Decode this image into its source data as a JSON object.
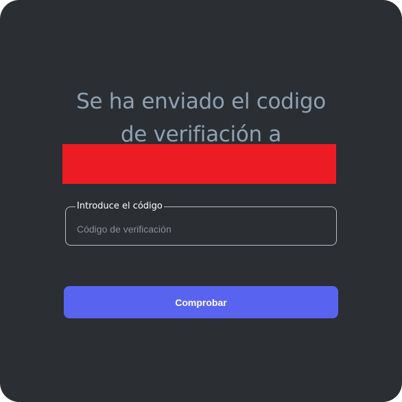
{
  "heading": {
    "line1": "Se ha enviado el codigo",
    "line2": "de verifiación a"
  },
  "redaction": {
    "color": "#ed1c24"
  },
  "code_field": {
    "label": "Introduce el código",
    "placeholder": "Código de verificación",
    "value": ""
  },
  "submit_button": {
    "label": "Comprobar",
    "color": "#5864f0"
  },
  "theme": {
    "background": "#2b2e33",
    "heading_color": "#8fa2b3"
  }
}
